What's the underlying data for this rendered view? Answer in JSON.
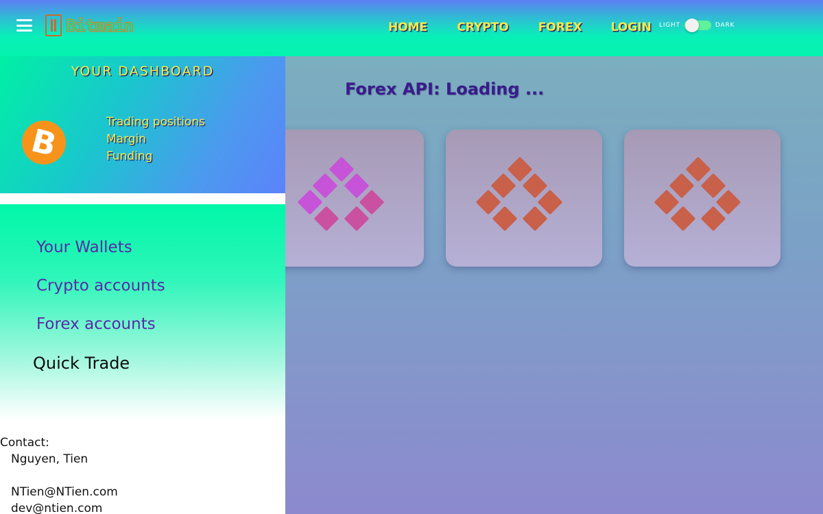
{
  "header": {
    "logo_text": "Bitmain",
    "nav": [
      {
        "label": "HOME"
      },
      {
        "label": "CRYPTO"
      },
      {
        "label": "FOREX"
      },
      {
        "label": "LOGIN"
      }
    ],
    "theme": {
      "light_label": "LIGHT",
      "dark_label": "DARK",
      "mode": "light"
    }
  },
  "sidebar": {
    "dashboard_title": "YOUR DASHBOARD",
    "coin_symbol": "B",
    "dashboard_links": [
      {
        "label": "Trading positions"
      },
      {
        "label": "Margin"
      },
      {
        "label": "Funding"
      }
    ],
    "menu": [
      {
        "label": "Your Wallets"
      },
      {
        "label": "Crypto accounts"
      },
      {
        "label": "Forex accounts"
      },
      {
        "label": "Quick Trade"
      }
    ],
    "contact": {
      "label": "Contact:",
      "name": "Nguyen, Tien",
      "emails": [
        "NTien@NTien.com",
        "dev@ntien.com"
      ]
    }
  },
  "main": {
    "title": "Forex API: Loading ...",
    "cards": [
      {
        "icon": "loading-spinner-icon",
        "color": "#c653d8"
      },
      {
        "icon": "loading-spinner-icon",
        "color": "#c8604a"
      },
      {
        "icon": "loading-spinner-icon",
        "color": "#c8604a"
      }
    ]
  },
  "colors": {
    "nav_text": "#f3e94b",
    "menu_text": "#5a2aa8",
    "title_text": "#3a1b8c",
    "bitcoin": "#f7931a"
  }
}
